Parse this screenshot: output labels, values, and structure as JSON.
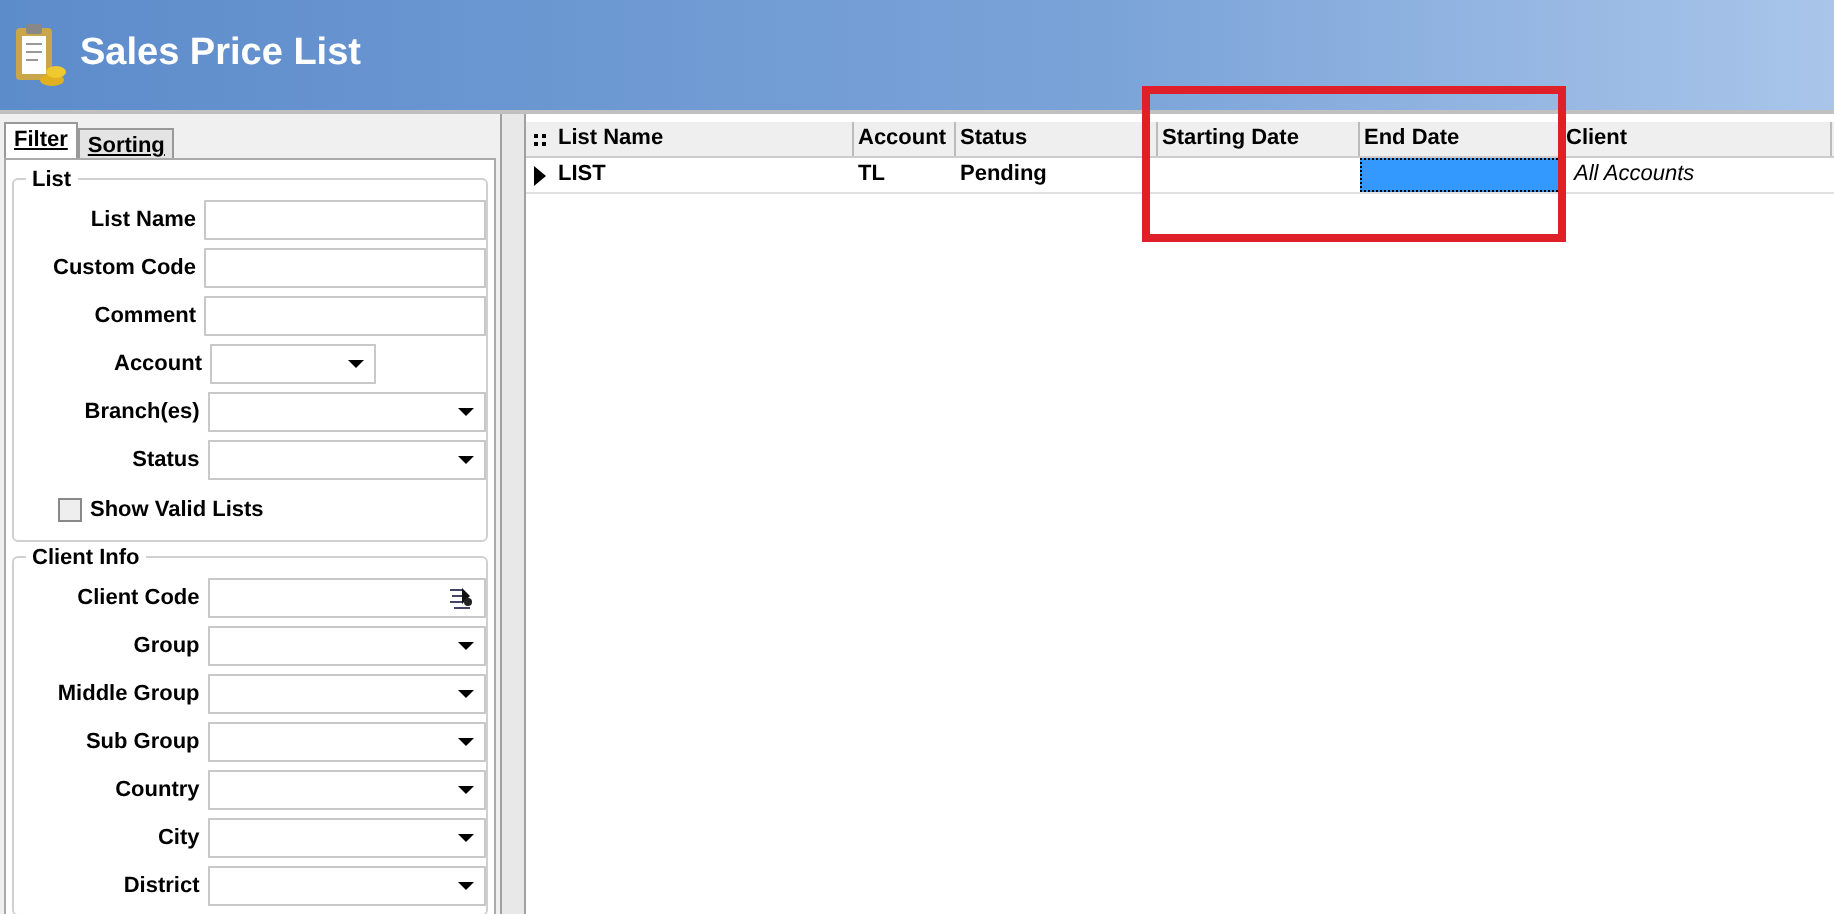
{
  "window": {
    "title": "Sales Price List"
  },
  "tabs": [
    {
      "label": "Filter",
      "selected": true
    },
    {
      "label": "Sorting",
      "selected": false
    }
  ],
  "groups": [
    {
      "title": "List",
      "fields": [
        {
          "label": "List Name",
          "kind": "text",
          "short": false
        },
        {
          "label": "Custom Code",
          "kind": "text",
          "short": false
        },
        {
          "label": "Comment",
          "kind": "text",
          "short": false
        },
        {
          "label": "Account",
          "kind": "dropdown",
          "short": true
        },
        {
          "label": "Branch(es)",
          "kind": "dropdown",
          "short": false
        },
        {
          "label": "Status",
          "kind": "dropdown",
          "short": false
        }
      ],
      "checkbox": {
        "label": "Show Valid Lists",
        "checked": false
      }
    },
    {
      "title": "Client Info",
      "fields": [
        {
          "label": "Client Code",
          "kind": "lookup",
          "short": false
        },
        {
          "label": "Group",
          "kind": "dropdown",
          "short": false
        },
        {
          "label": "Middle Group",
          "kind": "dropdown",
          "short": false
        },
        {
          "label": "Sub Group",
          "kind": "dropdown",
          "short": false
        },
        {
          "label": "Country",
          "kind": "dropdown",
          "short": false
        },
        {
          "label": "City",
          "kind": "dropdown",
          "short": false
        },
        {
          "label": "District",
          "kind": "dropdown",
          "short": false
        }
      ]
    }
  ],
  "annotation": {
    "kind": "frame",
    "color": "#e02028"
  },
  "table": {
    "columns": [
      {
        "label": "List Name"
      },
      {
        "label": "Account"
      },
      {
        "label": "Status"
      },
      {
        "label": "Starting Date"
      },
      {
        "label": "End Date"
      },
      {
        "label": "Client"
      }
    ],
    "rows": [
      {
        "current": true,
        "cells": [
          {
            "text": "LIST",
            "selected": false
          },
          {
            "text": "TL",
            "selected": false
          },
          {
            "text": "Pending",
            "selected": false
          },
          {
            "text": "",
            "selected": false
          },
          {
            "text": "",
            "selected": true
          },
          {
            "text": "All Accounts",
            "selected": false
          }
        ]
      }
    ]
  }
}
